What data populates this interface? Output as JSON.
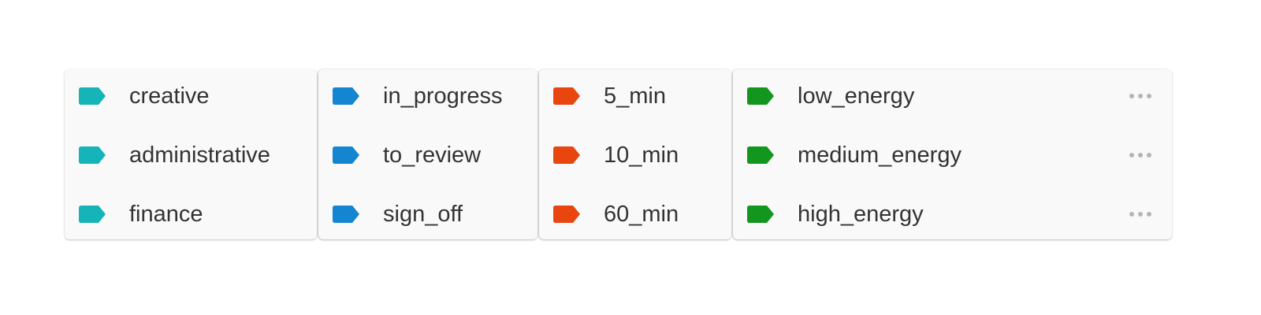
{
  "groups": [
    {
      "color": "#14b4b8",
      "tags": [
        {
          "label": "creative"
        },
        {
          "label": "administrative"
        },
        {
          "label": "finance"
        }
      ]
    },
    {
      "color": "#1485d0",
      "tags": [
        {
          "label": "in_progress"
        },
        {
          "label": "to_review"
        },
        {
          "label": "sign_off"
        }
      ]
    },
    {
      "color": "#e8450f",
      "tags": [
        {
          "label": "5_min"
        },
        {
          "label": "10_min"
        },
        {
          "label": "60_min"
        }
      ]
    },
    {
      "color": "#12961e",
      "tags": [
        {
          "label": "low_energy",
          "menu_icon": "more-horizontal-icon"
        },
        {
          "label": "medium_energy",
          "menu_icon": "more-horizontal-icon"
        },
        {
          "label": "high_energy",
          "menu_icon": "more-horizontal-icon"
        }
      ]
    }
  ],
  "tag_icon": "tag-icon"
}
